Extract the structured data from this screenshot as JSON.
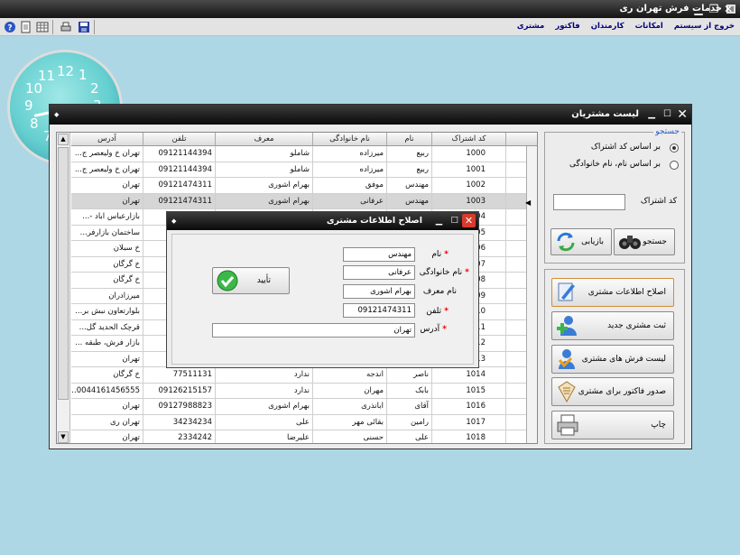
{
  "app": {
    "title": "خدمات فرش تهران ری"
  },
  "menu": [
    "مشتری",
    "فاکتور",
    "کارمندان",
    "امکانات",
    "خروج از سیستم"
  ],
  "clock": {
    "numbers": [
      "12",
      "1",
      "2",
      "11",
      "10",
      "9",
      "8",
      "3",
      "7"
    ]
  },
  "customers_window": {
    "title": "لیست مشتریان",
    "columns": {
      "code": "کد اشتراک",
      "first": "نام",
      "last": "نام خانوادگی",
      "ref": "معرف",
      "phone": "تلفن",
      "addr": "آدرس"
    },
    "rows": [
      {
        "code": "1000",
        "first": "ربیع",
        "last": "میرزاده",
        "ref": "شاملو",
        "phone": "09121144394",
        "addr": "تهران خ ولیعصر ج..."
      },
      {
        "code": "1001",
        "first": "ربیع",
        "last": "میرزاده",
        "ref": "شاملو",
        "phone": "09121144394",
        "addr": "تهران خ ولیعصر ج..."
      },
      {
        "code": "1002",
        "first": "مهندس",
        "last": "موفق",
        "ref": "بهرام اشوری",
        "phone": "09121474311",
        "addr": "تهران"
      },
      {
        "code": "1003",
        "first": "مهندس",
        "last": "عرفانی",
        "ref": "بهرام اشوری",
        "phone": "09121474311",
        "addr": "تهران"
      },
      {
        "code": "1004",
        "first": "",
        "last": "",
        "ref": "",
        "phone": "",
        "addr": "بازارعباس اباد -..."
      },
      {
        "code": "1005",
        "first": "",
        "last": "",
        "ref": "",
        "phone": "",
        "addr": "ساختمان بازارفر..."
      },
      {
        "code": "1006",
        "first": "",
        "last": "",
        "ref": "",
        "phone": "",
        "addr": "خ سبلان"
      },
      {
        "code": "1007",
        "first": "",
        "last": "",
        "ref": "",
        "phone": "",
        "addr": "خ گرگان"
      },
      {
        "code": "1008",
        "first": "",
        "last": "",
        "ref": "",
        "phone": "",
        "addr": "خ گرگان"
      },
      {
        "code": "1009",
        "first": "",
        "last": "",
        "ref": "",
        "phone": "",
        "addr": "میرزادران"
      },
      {
        "code": "1010",
        "first": "",
        "last": "",
        "ref": "",
        "phone": "",
        "addr": "بلوارتعاون نبش بر..."
      },
      {
        "code": "1011",
        "first": "",
        "last": "",
        "ref": "",
        "phone": "",
        "addr": "قرچک الحدید گل..."
      },
      {
        "code": "1012",
        "first": "",
        "last": "",
        "ref": "",
        "phone": "",
        "addr": "بازار فرش، طبقه ..."
      },
      {
        "code": "1013",
        "first": "",
        "last": "",
        "ref": "",
        "phone": "",
        "addr": "تهران"
      },
      {
        "code": "1014",
        "first": "ناصر",
        "last": "اندجه",
        "ref": "ندارد",
        "phone": "77511131",
        "addr": "خ گرگان"
      },
      {
        "code": "1015",
        "first": "بابک",
        "last": "مهران",
        "ref": "ندارد",
        "phone": "09126215157",
        "addr": "0044161456555..."
      },
      {
        "code": "1016",
        "first": "آقای",
        "last": "ابانذری",
        "ref": "بهرام اشوری",
        "phone": "09127988823",
        "addr": "تهران"
      },
      {
        "code": "1017",
        "first": "رامین",
        "last": "بقائی مهر",
        "ref": "علی",
        "phone": "34234234",
        "addr": "تهران ری"
      },
      {
        "code": "1018",
        "first": "علی",
        "last": "حسنی",
        "ref": "علیرضا",
        "phone": "2334242",
        "addr": "تهران"
      }
    ]
  },
  "search_panel": {
    "link": "جستجو",
    "radio1": "بر اساس کد اشتراک",
    "radio2": "بر اساس نام، نام خانوادگی",
    "code_label": "کد اشتراک",
    "code_value": "",
    "search_btn": "جستجو",
    "reset_btn": "بازیابی"
  },
  "actions": {
    "edit": "اصلاح اطلاعات مشتری",
    "new": "ثبت مشتری جدید",
    "carpets": "لیست فرش های مشتری",
    "invoice": "صدور فاکتور برای مشتری",
    "print": "چاپ"
  },
  "edit_dialog": {
    "title": "اصلاح اطلاعات مشتری",
    "labels": {
      "first": "نام",
      "last": "نام خانوادگی",
      "ref": "نام معرف",
      "phone": "تلفن",
      "addr": "آدرس"
    },
    "values": {
      "first": "مهندس",
      "last": "عرفانی",
      "ref": "بهرام اشوری",
      "phone": "09121474311",
      "addr": "تهران"
    },
    "ok": "تأیید"
  }
}
